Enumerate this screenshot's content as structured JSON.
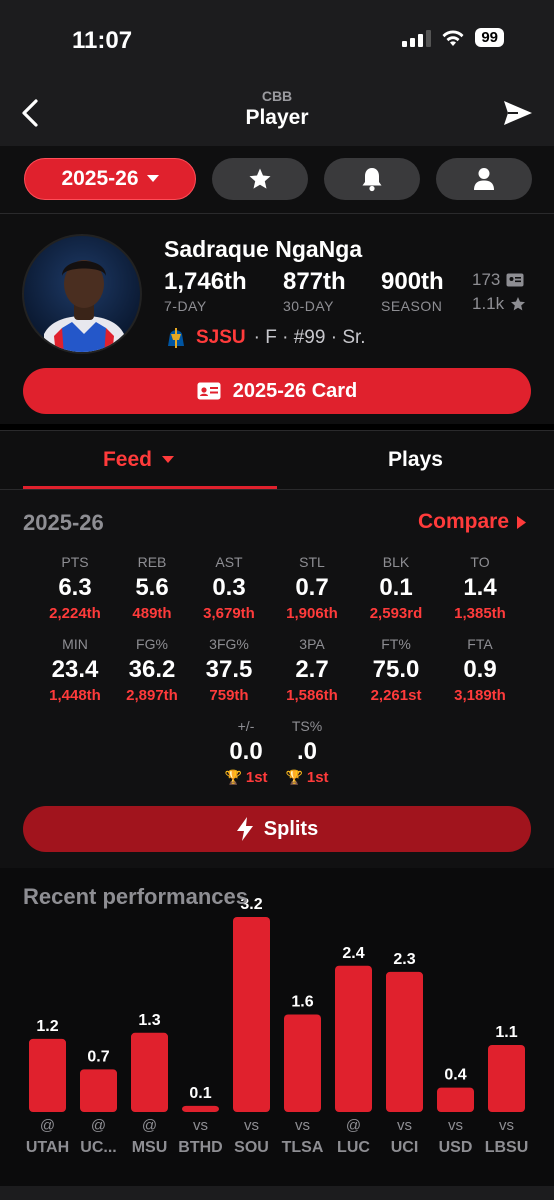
{
  "status": {
    "time": "11:07",
    "battery": "99"
  },
  "nav": {
    "subtitle": "CBB",
    "title": "Player"
  },
  "filters": {
    "season_label": "2025-26"
  },
  "player": {
    "name": "Sadraque NgaNga",
    "ranks": [
      {
        "value": "1,746th",
        "label": "7-DAY"
      },
      {
        "value": "877th",
        "label": "30-DAY"
      },
      {
        "value": "900th",
        "label": "SEASON"
      }
    ],
    "cards_count": "173",
    "favorites_count": "1.1k",
    "team": "SJSU",
    "details": "· F · #99 · Sr.",
    "card_button": "2025-26 Card"
  },
  "tabs": {
    "feed": "Feed",
    "plays": "Plays"
  },
  "stats": {
    "season": "2025-26",
    "compare": "Compare",
    "row1": [
      {
        "label": "PTS",
        "value": "6.3",
        "rank": "2,224th"
      },
      {
        "label": "REB",
        "value": "5.6",
        "rank": "489th"
      },
      {
        "label": "AST",
        "value": "0.3",
        "rank": "3,679th"
      },
      {
        "label": "STL",
        "value": "0.7",
        "rank": "1,906th"
      },
      {
        "label": "BLK",
        "value": "0.1",
        "rank": "2,593rd"
      },
      {
        "label": "TO",
        "value": "1.4",
        "rank": "1,385th"
      }
    ],
    "row2": [
      {
        "label": "MIN",
        "value": "23.4",
        "rank": "1,448th"
      },
      {
        "label": "FG%",
        "value": "36.2",
        "rank": "2,897th"
      },
      {
        "label": "3FG%",
        "value": "37.5",
        "rank": "759th"
      },
      {
        "label": "3PA",
        "value": "2.7",
        "rank": "1,586th"
      },
      {
        "label": "FT%",
        "value": "75.0",
        "rank": "2,261st"
      },
      {
        "label": "FTA",
        "value": "0.9",
        "rank": "3,189th"
      }
    ],
    "row3": [
      {
        "label": "+/-",
        "value": "0.0",
        "rank": "1st"
      },
      {
        "label": "TS%",
        "value": ".0",
        "rank": "1st"
      }
    ],
    "splits_button": "Splits"
  },
  "recent": {
    "title": "Recent performances"
  },
  "chart_data": {
    "type": "bar",
    "title": "Recent performances",
    "categories": [
      "UTAH",
      "UC...",
      "MSU",
      "BTHD",
      "SOU",
      "TLSA",
      "LUC",
      "UCI",
      "USD",
      "LBSU"
    ],
    "prefixes": [
      "@",
      "@",
      "@",
      "vs",
      "vs",
      "vs",
      "@",
      "vs",
      "vs",
      "vs"
    ],
    "values": [
      1.2,
      0.7,
      1.3,
      0.1,
      3.2,
      1.6,
      2.4,
      2.3,
      0.4,
      1.1
    ],
    "value_labels": [
      "1.2",
      "0.7",
      "1.3",
      "0.1",
      "3.2",
      "1.6",
      "2.4",
      "2.3",
      "0.4",
      "1.1"
    ],
    "ylim": [
      0,
      3.2
    ],
    "bar_color": "#e0212d",
    "grid": false
  },
  "colors": {
    "accent": "#e0212d",
    "accent_text": "#ff3b3b",
    "muted": "#8e8e93",
    "trophy": "#f5a623"
  }
}
